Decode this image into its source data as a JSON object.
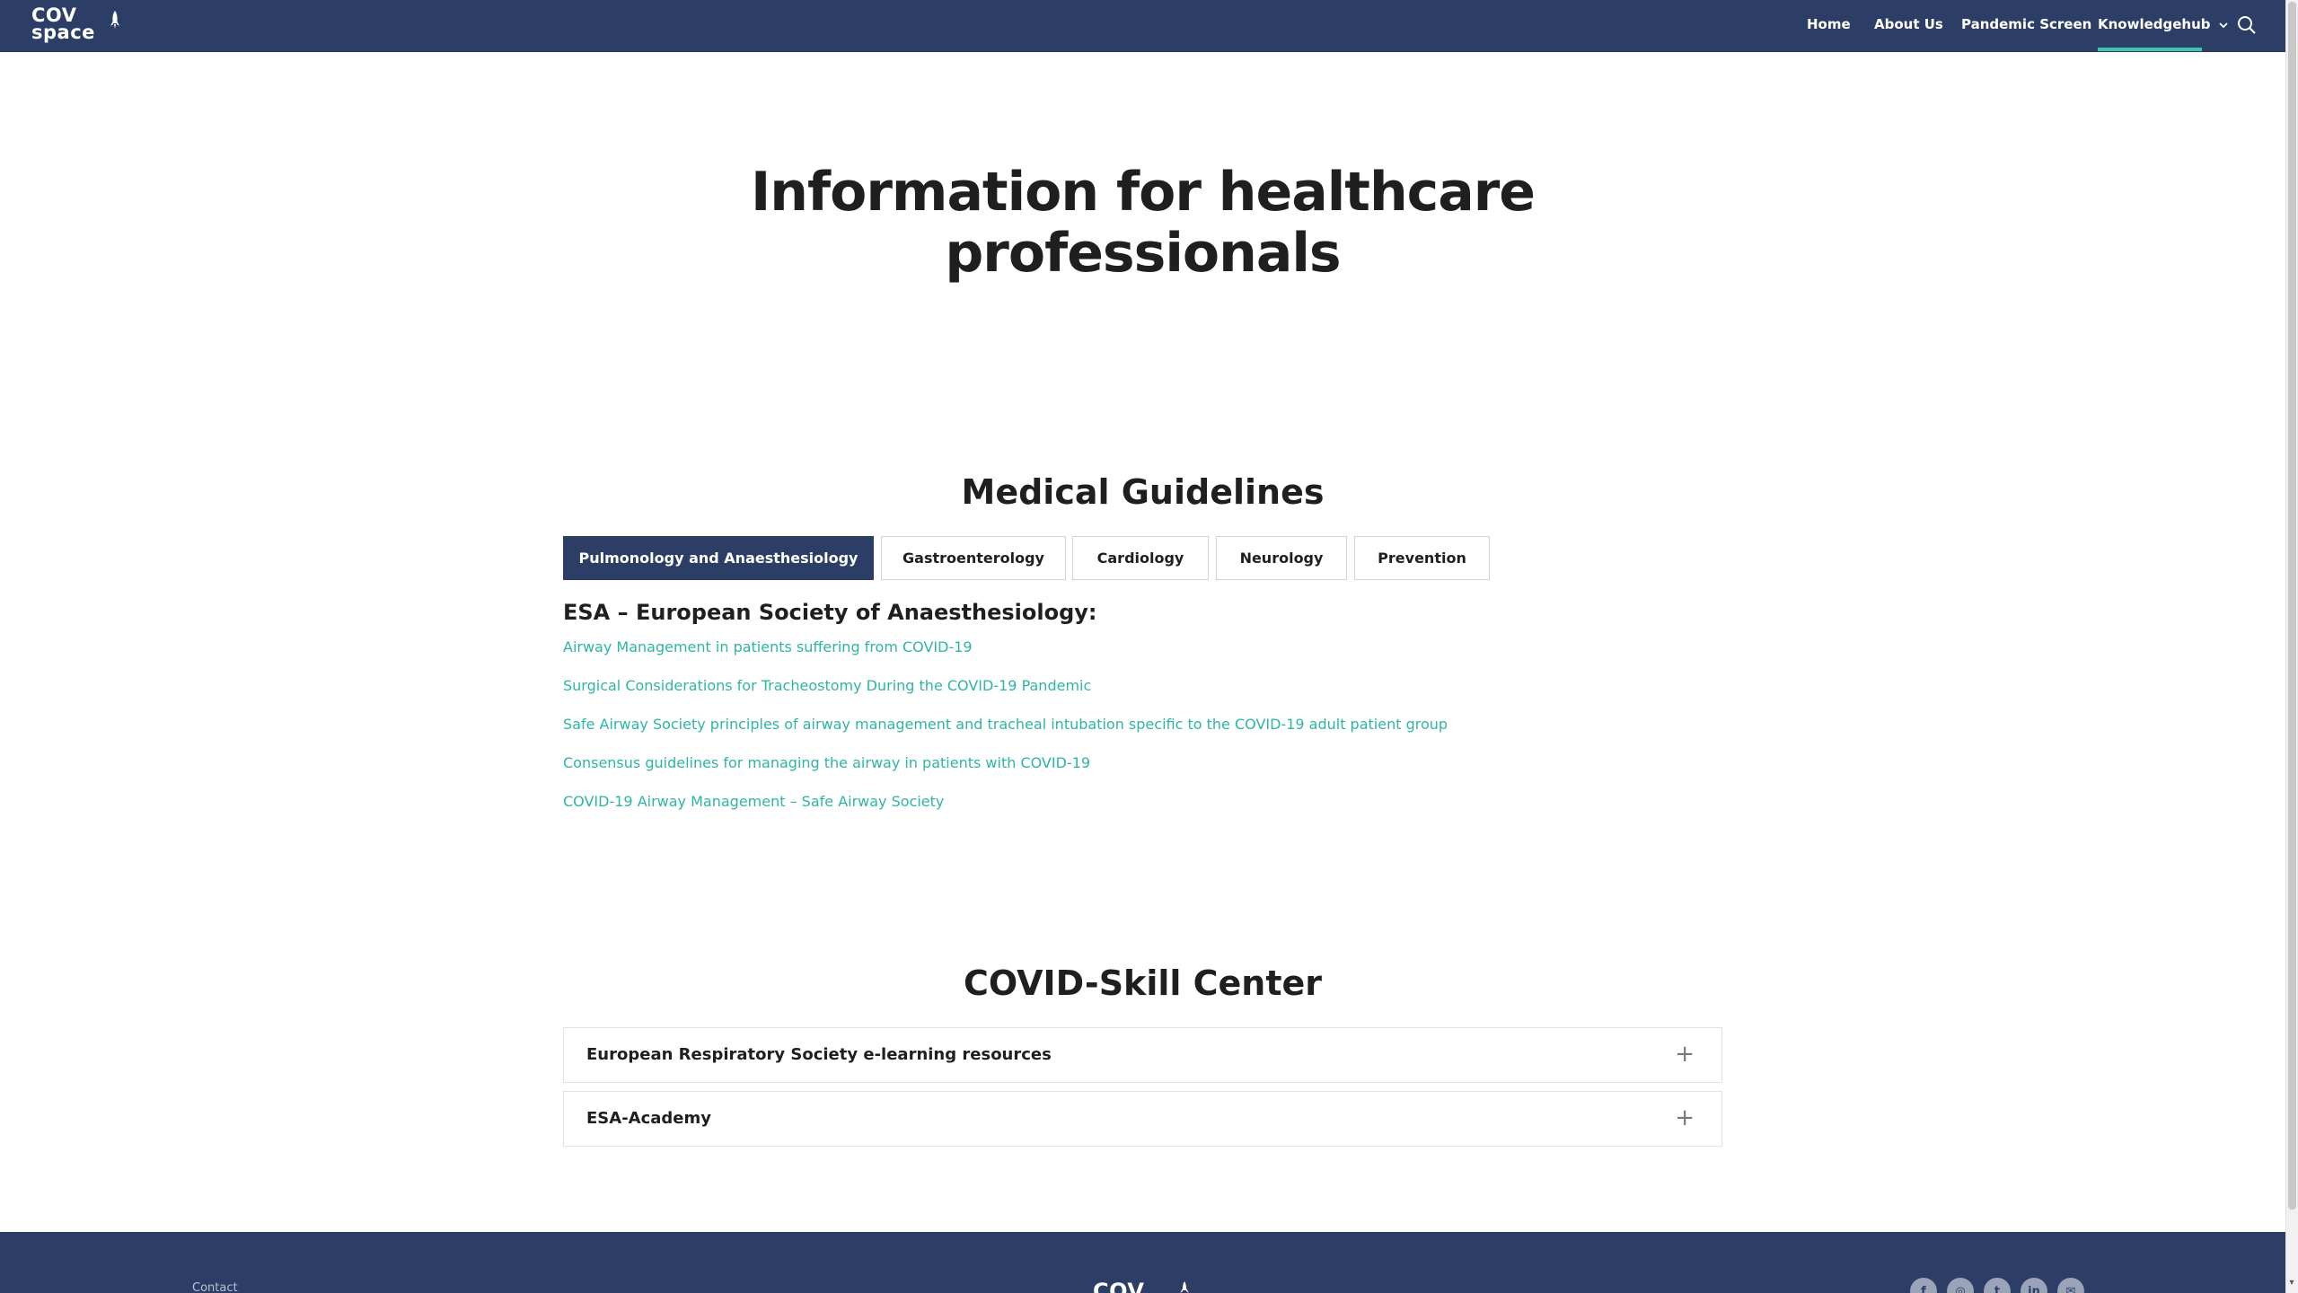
{
  "header": {
    "logo_line1": "COV",
    "logo_line2": "space",
    "nav": [
      {
        "label": "Home"
      },
      {
        "label": "About Us"
      },
      {
        "label": "Pandemic Screen"
      },
      {
        "label": "Knowledgehub",
        "active": true,
        "dropdown": true
      }
    ],
    "icons": {
      "search": "search-icon",
      "rocket": "rocket-icon",
      "dropdown": "chevron-down-icon"
    }
  },
  "hero": {
    "title_line1": "Information for healthcare",
    "title_line2": "professionals"
  },
  "guidelines": {
    "title": "Medical Guidelines",
    "tabs": [
      {
        "label": "Pulmonology and Anaesthesiology",
        "active": true
      },
      {
        "label": "Gastroenterology"
      },
      {
        "label": "Cardiology"
      },
      {
        "label": "Neurology"
      },
      {
        "label": "Prevention"
      }
    ],
    "heading": "ESA – European Society of Anaesthesiology:",
    "links": [
      "Airway Management in patients suffering from COVID-19",
      "Surgical Considerations for Tracheostomy During the COVID-19 Pandemic",
      "Safe Airway Society principles of airway management and tracheal intubation specific to the COVID-19 adult patient group",
      "Consensus guidelines for managing the airway in patients with COVID-19",
      "COVID-19 Airway Management – Safe Airway Society"
    ]
  },
  "skill_center": {
    "title": "COVID-Skill Center",
    "items": [
      {
        "label": "European Respiratory Society e-learning resources",
        "toggle": "+"
      },
      {
        "label": "ESA-Academy",
        "toggle": "+"
      }
    ]
  },
  "footer": {
    "contact": "Contact",
    "logo": "COV",
    "social_icons": [
      "facebook-icon",
      "instagram-icon",
      "twitter-icon",
      "linkedin-icon",
      "mail-icon"
    ],
    "social_glyphs": [
      "f",
      "◎",
      "t",
      "in",
      "✉"
    ]
  },
  "colors": {
    "navy": "#2c3e66",
    "teal": "#2fb5a3",
    "accent_underline": "#3ec4b3"
  }
}
